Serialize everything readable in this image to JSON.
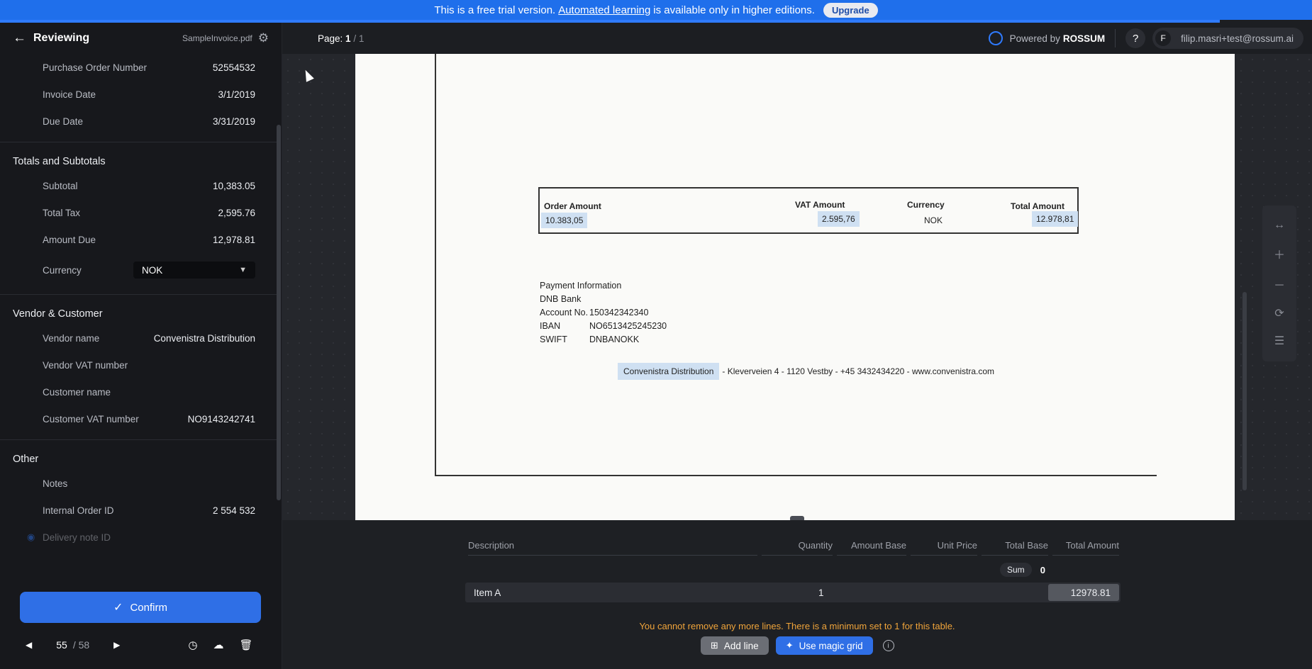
{
  "banner": {
    "text_before": "This is a free trial version.",
    "link": "Automated learning",
    "text_after": "is available only in higher editions.",
    "upgrade_label": "Upgrade"
  },
  "sidebar": {
    "title": "Reviewing",
    "filename": "SampleInvoice.pdf",
    "basic_rows": [
      {
        "label": "Purchase Order Number",
        "value": "52554532"
      },
      {
        "label": "Invoice Date",
        "value": "3/1/2019"
      },
      {
        "label": "Due Date",
        "value": "3/31/2019"
      }
    ],
    "totals": {
      "heading": "Totals and Subtotals",
      "rows": [
        {
          "label": "Subtotal",
          "value": "10,383.05"
        },
        {
          "label": "Total Tax",
          "value": "2,595.76"
        },
        {
          "label": "Amount Due",
          "value": "12,978.81"
        }
      ],
      "currency_label": "Currency",
      "currency_value": "NOK"
    },
    "vendor": {
      "heading": "Vendor & Customer",
      "rows": [
        {
          "label": "Vendor name",
          "value": "Convenistra Distribution"
        },
        {
          "label": "Vendor VAT number",
          "value": ""
        },
        {
          "label": "Customer name",
          "value": ""
        },
        {
          "label": "Customer VAT number",
          "value": "NO9143242741"
        }
      ]
    },
    "other": {
      "heading": "Other",
      "rows": [
        {
          "label": "Notes",
          "value": ""
        },
        {
          "label": "Internal Order ID",
          "value": "2 554 532"
        },
        {
          "label": "Delivery note ID",
          "value": ""
        }
      ]
    },
    "confirm_label": "Confirm",
    "pager": {
      "current": "55",
      "total": "/ 58"
    }
  },
  "topbar": {
    "page_label": "Page:",
    "page_current": "1",
    "page_sep": "/",
    "page_total": "1",
    "powered_by": "Powered by",
    "brand": "ROSSUM",
    "help": "?",
    "avatar": "F",
    "user_email": "filip.masri+test@rossum.ai"
  },
  "document": {
    "header_order": "Order Amount",
    "header_vat": "VAT Amount",
    "header_currency": "Currency",
    "header_total": "Total Amount",
    "order_amount": "10.383,05",
    "vat_amount": "2.595,76",
    "currency": "NOK",
    "total_amount": "12.978,81",
    "payment_title": "Payment Information",
    "bank": "DNB Bank",
    "account_label": "Account No.",
    "account_value": "150342342340",
    "iban_label": "IBAN",
    "iban_value": "NO6513425245230",
    "swift_label": "SWIFT",
    "swift_value": "DNBANOKK",
    "vendor_name": "Convenistra Distribution",
    "vendor_rest": "- Kleverveien 4 - 1120 Vestby - +45 3432434220 - www.convenistra.com"
  },
  "line_items": {
    "columns": [
      "Description",
      "Quantity",
      "Amount Base",
      "Unit Price",
      "Total Base",
      "Total Amount"
    ],
    "sum_label": "Sum",
    "sum_value": "0",
    "rows": [
      {
        "description": "Item A",
        "quantity": "1",
        "total_amount": "12978.81"
      }
    ],
    "warning": "You cannot remove any more lines. There is a minimum set to 1 for this table.",
    "add_line_label": "Add line",
    "magic_grid_label": "Use magic grid"
  }
}
